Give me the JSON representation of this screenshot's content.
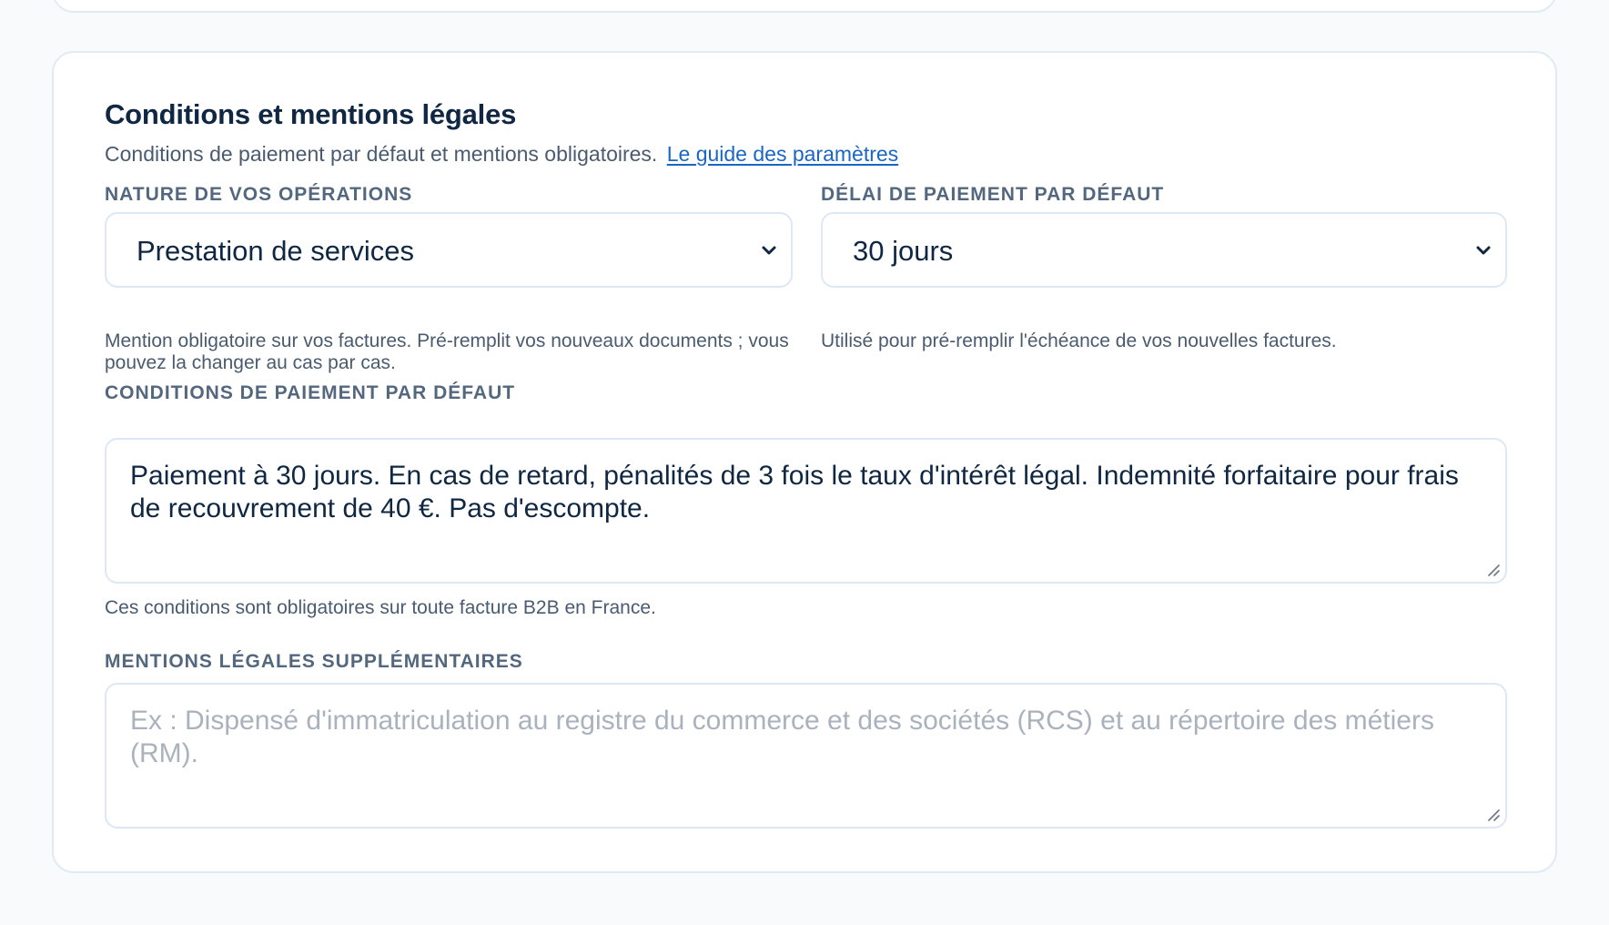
{
  "section": {
    "title": "Conditions et mentions légales",
    "subtitle": "Conditions de paiement par défaut et mentions obligatoires.",
    "guide_link": "Le guide des paramètres"
  },
  "nature_operations": {
    "label": "NATURE DE VOS OPÉRATIONS",
    "value": "Prestation de services",
    "hint": "Mention obligatoire sur vos factures. Pré-remplit vos nouveaux documents ; vous pouvez la changer au cas par cas."
  },
  "delai_paiement": {
    "label": "DÉLAI DE PAIEMENT PAR DÉFAUT",
    "value": "30 jours",
    "hint": "Utilisé pour pré-remplir l'échéance de vos nouvelles factures."
  },
  "conditions_paiement": {
    "label": "CONDITIONS DE PAIEMENT PAR DÉFAUT",
    "value": "Paiement à 30 jours. En cas de retard, pénalités de 3 fois le taux d'intérêt légal. Indemnité forfaitaire pour frais de recouvrement de 40 €. Pas d'escompte.",
    "hint": "Ces conditions sont obligatoires sur toute facture B2B en France."
  },
  "mentions_legales": {
    "label": "MENTIONS LÉGALES SUPPLÉMENTAIRES",
    "value": "",
    "placeholder": "Ex : Dispensé d'immatriculation au registre du commerce et des sociétés (RCS) et au répertoire des métiers (RM)."
  },
  "icons": {
    "select_chevron": "chevron-down-icon",
    "resize_handle": "resize-handle-icon"
  },
  "colors": {
    "page_bg": "#f8fafc",
    "heading": "#0f2742",
    "label": "#53677e",
    "link": "#1a66c8",
    "border": "#dce8f6",
    "placeholder": "#a9b2bd"
  }
}
